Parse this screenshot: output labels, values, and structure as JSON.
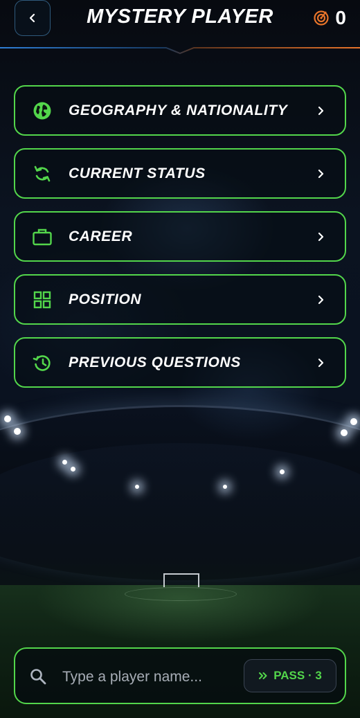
{
  "header": {
    "title": "MYSTERY PLAYER",
    "score": "0",
    "back_icon": "chevron-left-icon",
    "score_icon": "target-icon"
  },
  "menu": {
    "items": [
      {
        "label": "GEOGRAPHY & NATIONALITY",
        "icon": "globe-icon"
      },
      {
        "label": "CURRENT STATUS",
        "icon": "refresh-icon"
      },
      {
        "label": "CAREER",
        "icon": "briefcase-icon"
      },
      {
        "label": "POSITION",
        "icon": "grid-icon"
      },
      {
        "label": "PREVIOUS QUESTIONS",
        "icon": "history-icon"
      }
    ]
  },
  "search": {
    "placeholder": "Type a player name...",
    "value": "",
    "pass_label": "PASS · 3",
    "pass_icon": "double-chevron-right-icon"
  },
  "colors": {
    "accent_green": "#53d64b",
    "accent_orange": "#e8742a",
    "accent_blue": "#2f7fd6",
    "text": "#ffffff"
  }
}
